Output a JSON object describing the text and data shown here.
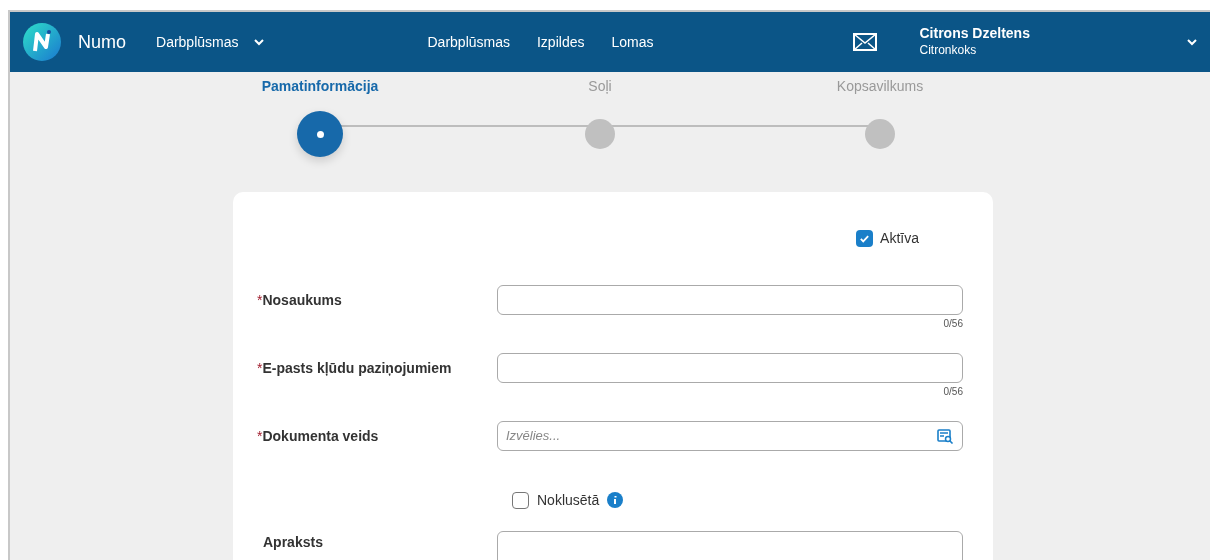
{
  "header": {
    "app_name": "Numo",
    "app_menu": "Darbplūsmas",
    "nav": [
      {
        "label": "Darbplūsmas"
      },
      {
        "label": "Izpildes"
      },
      {
        "label": "Lomas"
      }
    ],
    "user": {
      "name": "Citrons Dzeltens",
      "org": "Citronkoks"
    }
  },
  "steps": [
    {
      "label": "Pamatinformācija",
      "selected": true
    },
    {
      "label": "Soļi",
      "selected": false
    },
    {
      "label": "Kopsavilkums",
      "selected": false
    }
  ],
  "active_checkbox": {
    "label": "Aktīva",
    "checked": true
  },
  "fields": [
    {
      "kind": "text",
      "label": "Nosaukums",
      "required_mark": "*",
      "counter": "0/56"
    },
    {
      "kind": "text",
      "label": "E-pasts kļūdu paziņojumiem",
      "required_mark": "*",
      "counter": "0/56"
    },
    {
      "kind": "select",
      "label": "Dokumenta veids",
      "required_mark": "*",
      "placeholder": "Izvēlies..."
    },
    {
      "kind": "checkbox",
      "label": "Noklusētā",
      "checked": false
    },
    {
      "kind": "textarea",
      "label": "Apraksts"
    }
  ]
}
